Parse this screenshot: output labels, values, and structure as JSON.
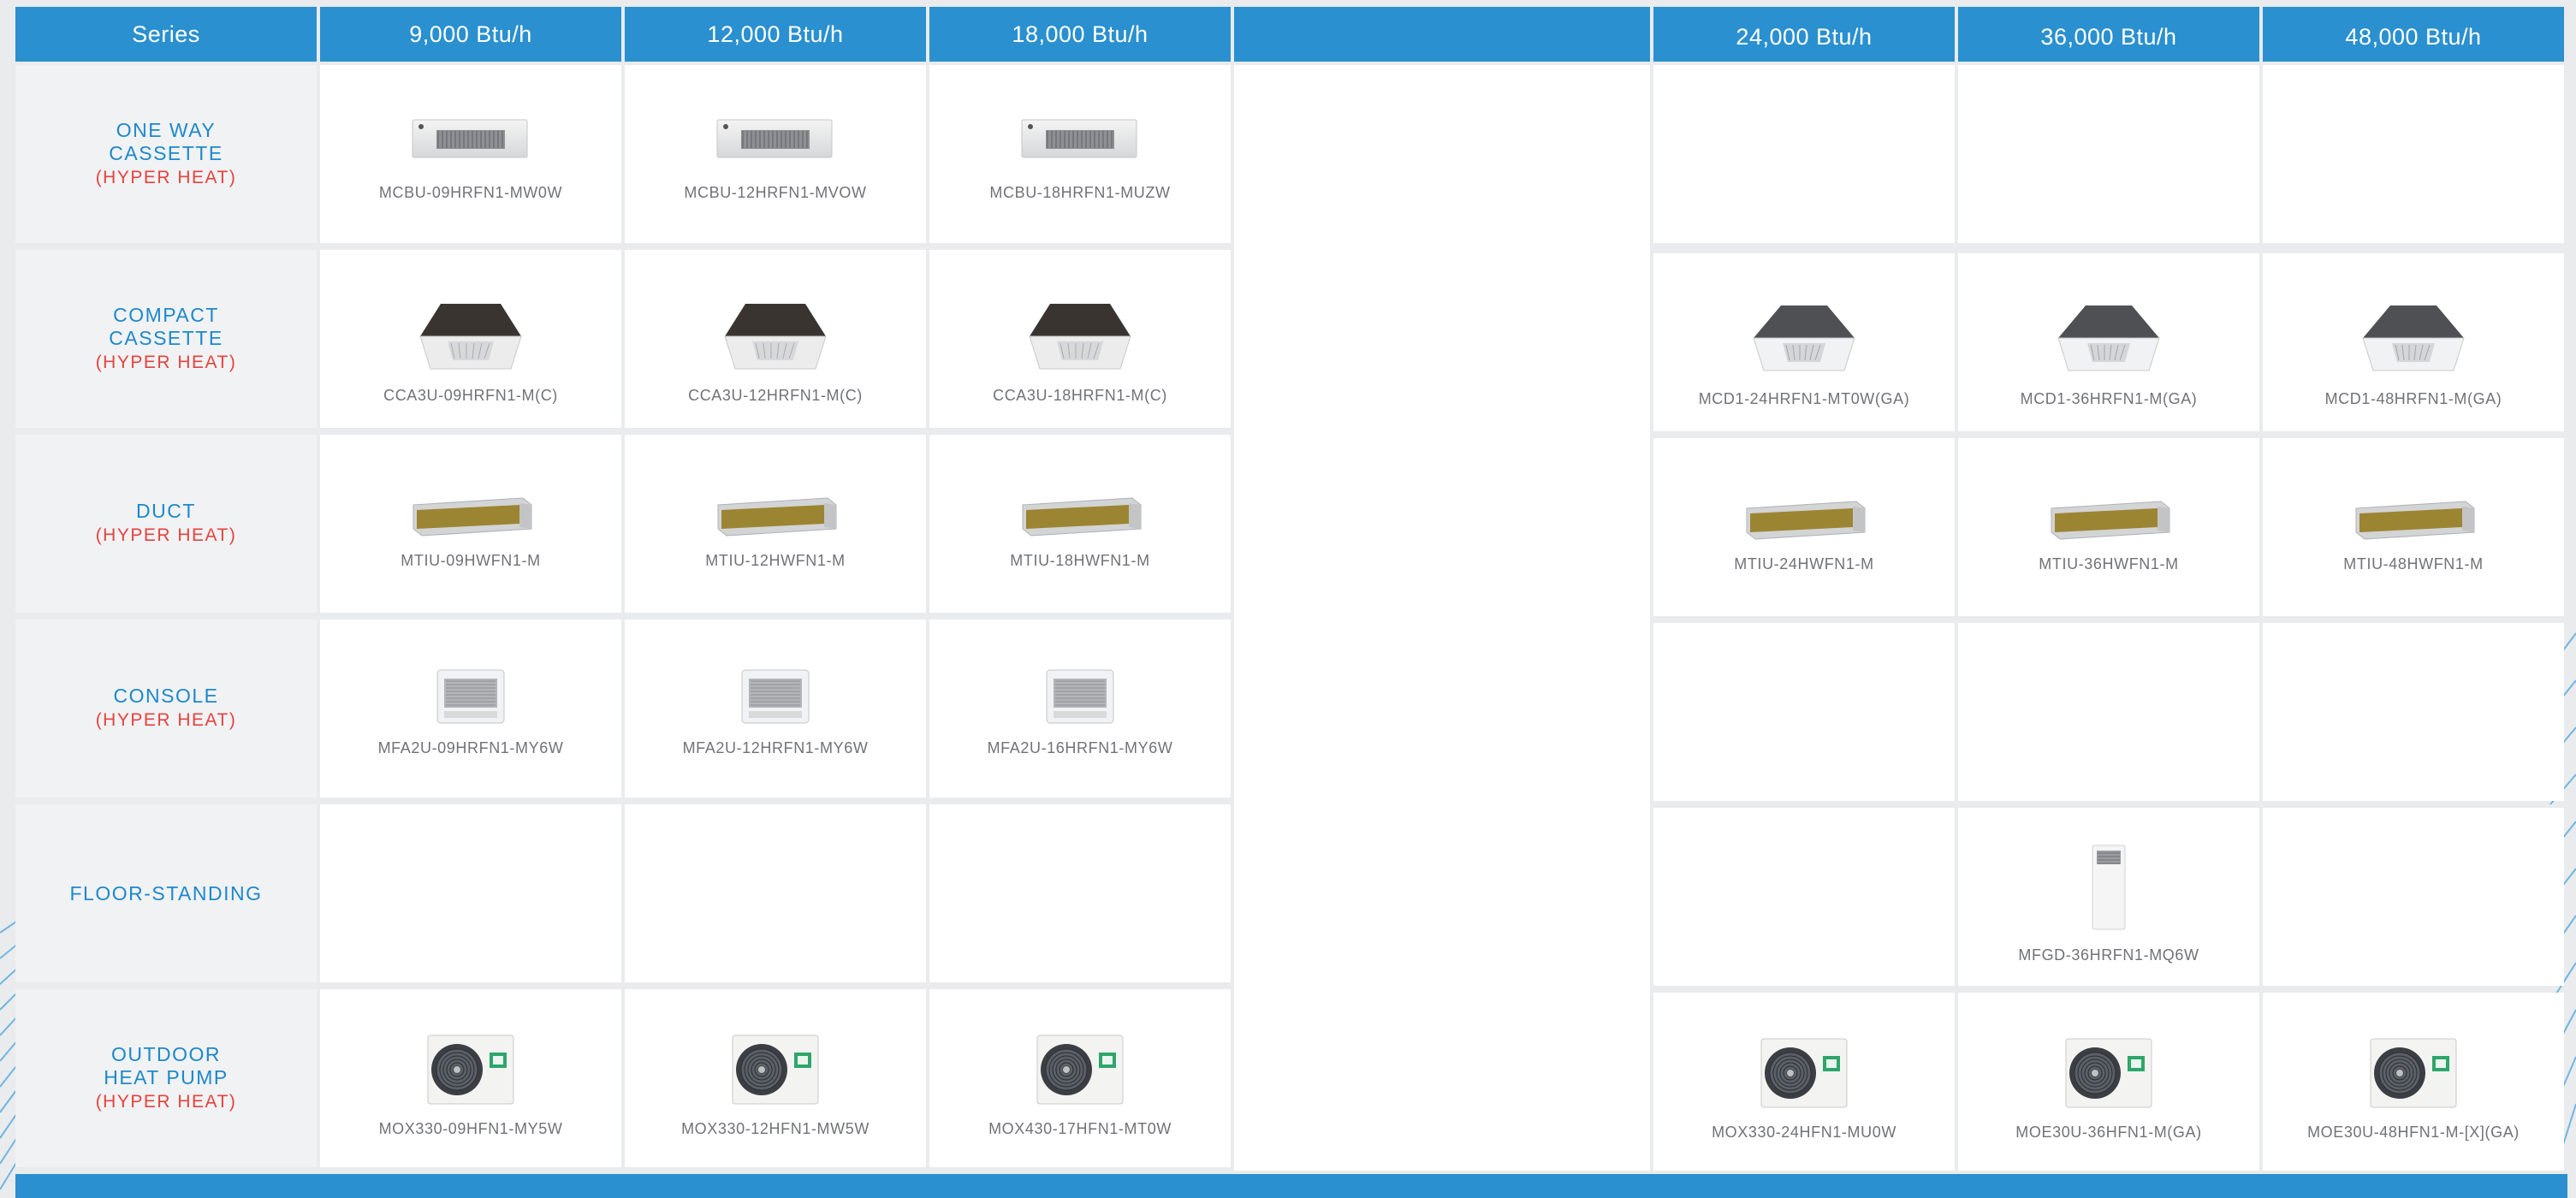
{
  "header": {
    "series_label": "Series",
    "capacities": [
      "9,000 Btu/h",
      "12,000 Btu/h",
      "18,000 Btu/h",
      "24,000 Btu/h",
      "36,000 Btu/h",
      "48,000 Btu/h"
    ]
  },
  "rows": [
    {
      "name": "ONE WAY\nCASSETTE",
      "sub": "(HYPER HEAT)",
      "icon": "one-way-cassette",
      "models": [
        "MCBU-09HRFN1-MW0W",
        "MCBU-12HRFN1-MVOW",
        "MCBU-18HRFN1-MUZW",
        "",
        "",
        ""
      ]
    },
    {
      "name": "COMPACT\nCASSETTE",
      "sub": "(HYPER HEAT)",
      "icon": "compact-cassette",
      "models": [
        "CCA3U-09HRFN1-M(C)",
        "CCA3U-12HRFN1-M(C)",
        "CCA3U-18HRFN1-M(C)",
        "MCD1-24HRFN1-MT0W(GA)",
        "MCD1-36HRFN1-M(GA)",
        "MCD1-48HRFN1-M(GA)"
      ]
    },
    {
      "name": "DUCT",
      "sub": "(HYPER HEAT)",
      "icon": "duct",
      "models": [
        "MTIU-09HWFN1-M",
        "MTIU-12HWFN1-M",
        "MTIU-18HWFN1-M",
        "MTIU-24HWFN1-M",
        "MTIU-36HWFN1-M",
        "MTIU-48HWFN1-M"
      ]
    },
    {
      "name": "CONSOLE",
      "sub": "(HYPER HEAT)",
      "icon": "console",
      "models": [
        "MFA2U-09HRFN1-MY6W",
        "MFA2U-12HRFN1-MY6W",
        "MFA2U-16HRFN1-MY6W",
        "",
        "",
        ""
      ]
    },
    {
      "name": "FLOOR-STANDING",
      "sub": "",
      "icon": "floor-standing",
      "models": [
        "",
        "",
        "",
        "",
        "MFGD-36HRFN1-MQ6W",
        ""
      ]
    },
    {
      "name": "OUTDOOR\nHEAT PUMP",
      "sub": "(HYPER HEAT)",
      "icon": "outdoor-unit",
      "models": [
        "MOX330-09HFN1-MY5W",
        "MOX330-12HFN1-MW5W",
        "MOX430-17HFN1-MT0W",
        "MOX330-24HFN1-MU0W",
        "MOE30U-36HFN1-M(GA)",
        "MOE30U-48HFN1-M-[X](GA)"
      ]
    }
  ],
  "colors": {
    "header_blue": "#2a90d0",
    "series_blue": "#1e88c9",
    "hyper_heat_red": "#e5433e",
    "label_bg": "#f0f2f4"
  }
}
